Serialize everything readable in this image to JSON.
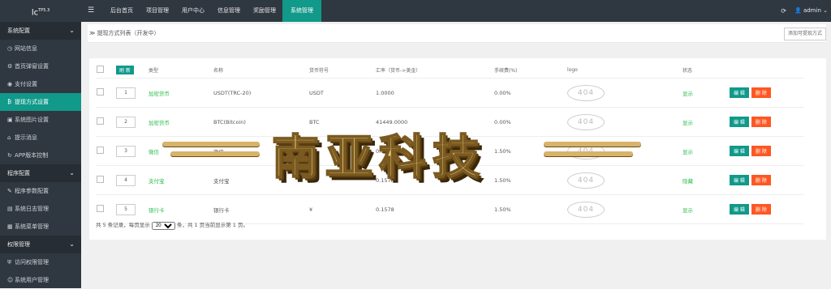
{
  "app": {
    "logo": "lc",
    "version": "TP5.3"
  },
  "sidebar": {
    "groups": [
      {
        "label": "系统配置",
        "items": [
          {
            "label": "网站信息",
            "icon": "clock-icon",
            "active": false
          },
          {
            "label": "首页弹窗设置",
            "icon": "settings-icon",
            "active": false
          },
          {
            "label": "支付设置",
            "icon": "target-icon",
            "active": false
          },
          {
            "label": "提现方式设置",
            "icon": "bitcoin-icon",
            "active": true
          },
          {
            "label": "系统图片设置",
            "icon": "image-icon",
            "active": false
          },
          {
            "label": "提示消息",
            "icon": "tag-icon",
            "active": false
          },
          {
            "label": "APP版本控制",
            "icon": "refresh-icon",
            "active": false
          }
        ]
      },
      {
        "label": "程序配置",
        "items": [
          {
            "label": "程序参数配置",
            "icon": "wrench-icon",
            "active": false
          },
          {
            "label": "系统日志管理",
            "icon": "log-icon",
            "active": false
          },
          {
            "label": "系统菜单管理",
            "icon": "menu-icon",
            "active": false
          }
        ]
      },
      {
        "label": "权限管理",
        "items": [
          {
            "label": "访问权限管理",
            "icon": "shield-icon",
            "active": false
          },
          {
            "label": "系统用户管理",
            "icon": "user-icon",
            "active": false
          }
        ]
      }
    ]
  },
  "topnav": {
    "items": [
      "后台首页",
      "项目管理",
      "用户中心",
      "信息管理",
      "奖励管理",
      "系统管理"
    ],
    "selected": "系统管理",
    "user": "admin"
  },
  "page": {
    "title": "提现方式列表（开发中）",
    "add_button": "添加可提现方式"
  },
  "table": {
    "refresh_label": "刷 新",
    "headers": [
      "类型",
      "名称",
      "货币符号",
      "汇率（货币->美金）",
      "手续费(%)",
      "logo",
      "状态"
    ],
    "edit_label": "编 辑",
    "delete_label": "删 除",
    "rows": [
      {
        "sort": "1",
        "type": "加密货币",
        "name": "USDT(TRC-20)",
        "symbol": "USDT",
        "rate": "1.0000",
        "fee": "0.00%",
        "logo": "404",
        "status": "显示"
      },
      {
        "sort": "2",
        "type": "加密货币",
        "name": "BTC(Bitcoin)",
        "symbol": "BTC",
        "rate": "41449.0000",
        "fee": "0.00%",
        "logo": "404",
        "status": "显示"
      },
      {
        "sort": "3",
        "type": "微信",
        "name": "微信",
        "symbol": "¥",
        "rate": "0.1578",
        "fee": "1.50%",
        "logo": "404",
        "status": "显示"
      },
      {
        "sort": "4",
        "type": "支付宝",
        "name": "支付宝",
        "symbol": "¥",
        "rate": "0.1578",
        "fee": "1.50%",
        "logo": "404",
        "status": "隐藏"
      },
      {
        "sort": "5",
        "type": "银行卡",
        "name": "银行卡",
        "symbol": "¥",
        "rate": "0.1578",
        "fee": "1.50%",
        "logo": "404",
        "status": "显示"
      }
    ]
  },
  "pager": {
    "prefix": "共 5 条记录，每页显示",
    "page_size": "20",
    "suffix": "条，共 1 页当前显示第 1 页。"
  },
  "watermark": {
    "text": "南亚科技"
  },
  "colors": {
    "sidebar": "#2f3740",
    "accent": "#11998a",
    "danger": "#ff5722",
    "green_text": "#2bbd4b"
  }
}
